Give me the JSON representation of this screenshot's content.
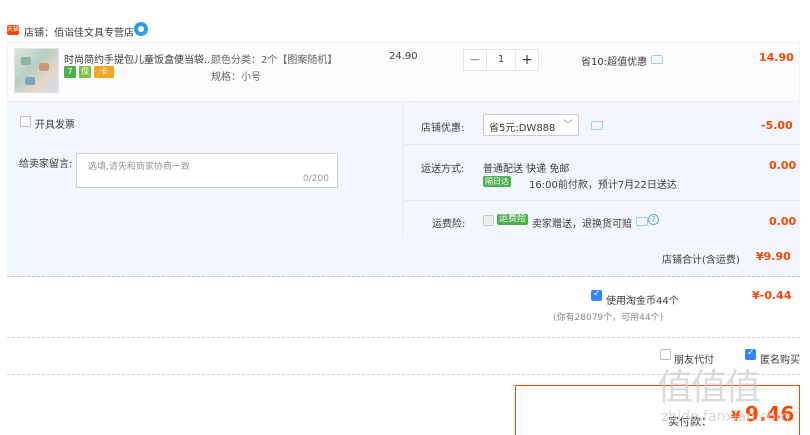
{
  "shop": {
    "badge": "天猫",
    "name": "店铺：佰诣佳文具专营店",
    "chat_icon": "wangwang-icon"
  },
  "item": {
    "title": "时尚简约手提包儿童饭盒便当袋...",
    "service_badges": [
      {
        "icon": "seven-day-return-icon",
        "text": "7",
        "color": "#4caf50"
      },
      {
        "icon": "guarantee-icon",
        "text": "保",
        "color": "#7dc242"
      },
      {
        "icon": "card-payment-icon",
        "text": "卡",
        "color": "#f5a623"
      }
    ],
    "sku_color": "颜色分类：2个【图案随机】",
    "sku_size": "规格：小号",
    "unit_price": "24.90",
    "quantity": "1",
    "minus": "−",
    "plus": "+",
    "saving": "省10:超值优惠",
    "subtotal": "14.90"
  },
  "invoice": {
    "label": "开具发票"
  },
  "message": {
    "label": "给卖家留言:",
    "placeholder": "选填,请先和商家协商一致",
    "counter": "0/200"
  },
  "shop_discount": {
    "label": "店铺优惠:",
    "selected": "省5元:DW888",
    "amount": "-5.00"
  },
  "shipping": {
    "label": "运送方式:",
    "method": "普通配送 快递 免邮",
    "tag": "隔日达",
    "eta": "16:00前付款，预计7月22日送达",
    "amount": "0.00"
  },
  "insurance": {
    "label": "运费险:",
    "tag": "运费险",
    "text": "卖家赠送，退换货可赔",
    "amount": "0.00"
  },
  "shop_total": {
    "label": "店铺合计(含运费)",
    "amount": "¥9.90"
  },
  "coins": {
    "label": "使用淘金币44个",
    "amount": "¥-0.44",
    "note": "(你有28079个，可用44个)"
  },
  "options": {
    "friend_pay": "朋友代付",
    "anonymous": "匿名购买"
  },
  "final": {
    "label": "实付款：",
    "amount": "9.46",
    "currency": "¥"
  },
  "watermark": {
    "glyphs": "值值值",
    "site": "zhide.fanxian.com"
  },
  "colors": {
    "accent": "#ff4400",
    "blue": "#3385ff",
    "panel": "#f2f7ff"
  }
}
